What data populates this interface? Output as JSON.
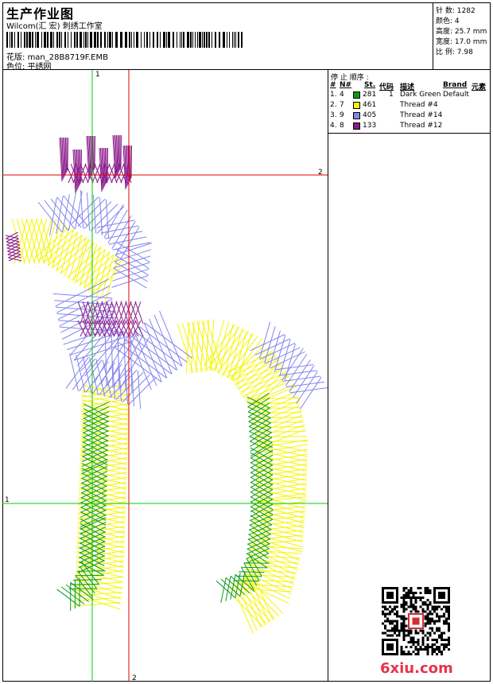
{
  "header": {
    "title": "生产作业图",
    "subtitle": "Wilcom(汇 宏) 刺绣工作室",
    "design_label": "花版: ",
    "design_file": "man_28B8719F.EMB",
    "colorway_label": "色位: ",
    "colorway": "平绣网"
  },
  "stats": {
    "stitches_label": "针 数: ",
    "stitches": "1282",
    "colors_label": "颜色: ",
    "colors": "4",
    "height_label": "高度: ",
    "height": "25.7 mm",
    "width_label": "宽度: ",
    "width": "17.0 mm",
    "scale_label": "比 例: ",
    "scale": "7.98"
  },
  "stop_sequence": {
    "title": "停 止 顺序 :",
    "columns": [
      "#",
      "N#",
      "St.",
      "代码",
      "描述",
      "Brand",
      "元素"
    ],
    "rows": [
      {
        "n": "1.",
        "needle": "4",
        "color": "#0a9a1a",
        "stitches": "281",
        "code": "1",
        "desc": "Dark Green",
        "brand": "Default"
      },
      {
        "n": "2.",
        "needle": "7",
        "color": "#f5f500",
        "stitches": "461",
        "code": "",
        "desc": "Thread #4",
        "brand": ""
      },
      {
        "n": "3.",
        "needle": "9",
        "color": "#8585f0",
        "stitches": "405",
        "code": "",
        "desc": "Thread #14",
        "brand": ""
      },
      {
        "n": "4.",
        "needle": "8",
        "color": "#8a1a8a",
        "stitches": "133",
        "code": "",
        "desc": "Thread #12",
        "brand": ""
      }
    ]
  },
  "guides": {
    "v1_label": "1",
    "h2_label": "2",
    "h1_label": "1",
    "v2_label": "2"
  },
  "watermark": "6xiu.com"
}
